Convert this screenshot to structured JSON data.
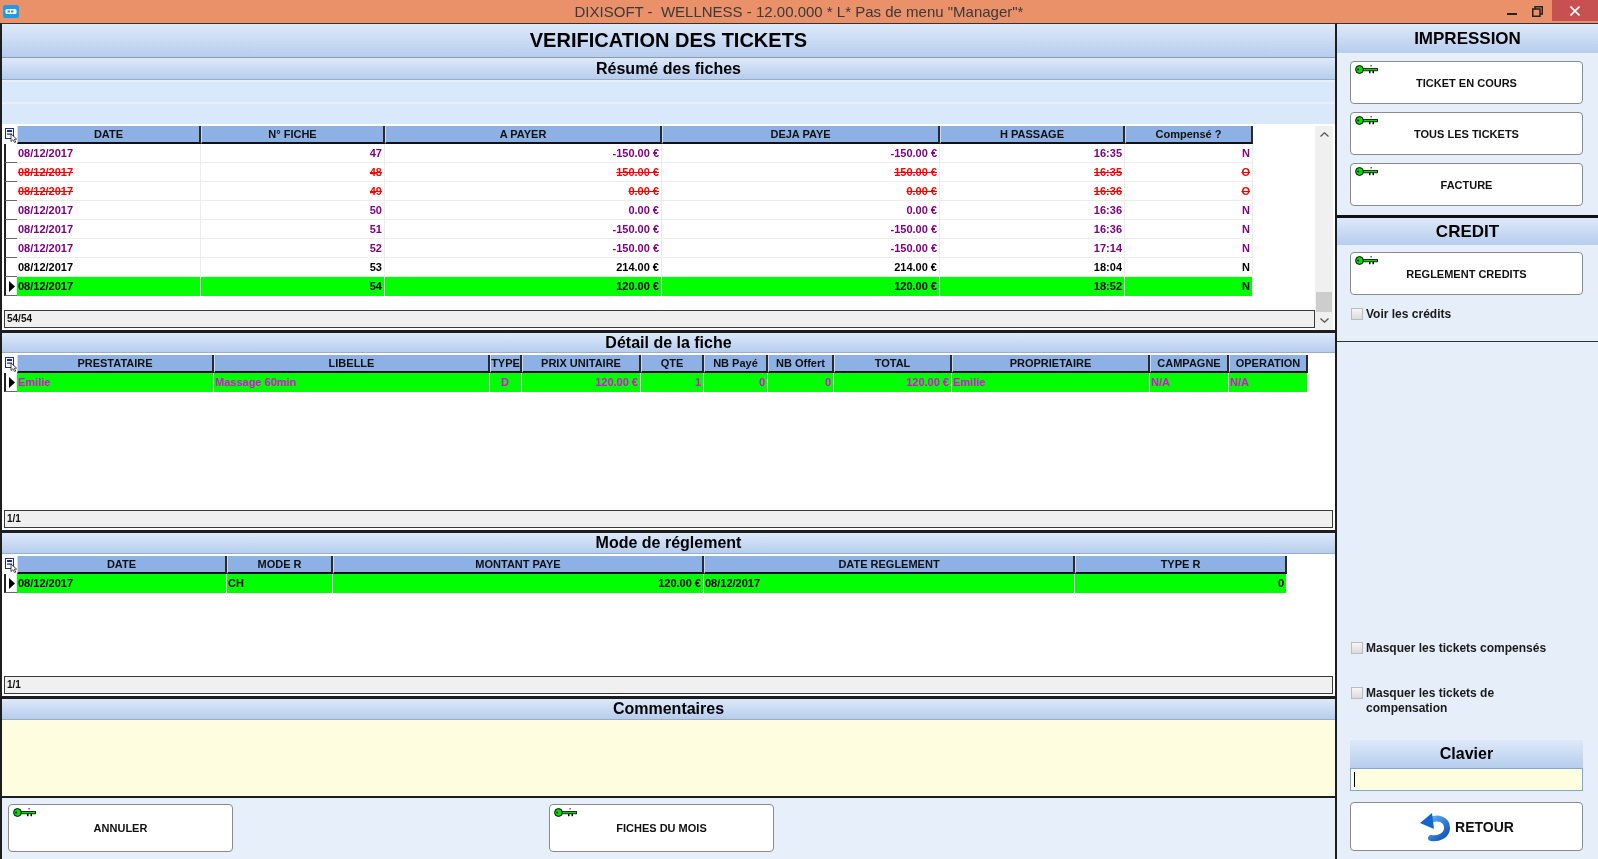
{
  "window": {
    "title": "DIXISOFT -  WELLNESS - 12.00.000 * L* Pas de menu \"Manager\"*"
  },
  "page_title": "VERIFICATION DES TICKETS",
  "summary": {
    "title": "Résumé des fiches",
    "columns": [
      "DATE",
      "N° FICHE",
      "A PAYER",
      "DEJA PAYE",
      "H PASSAGE",
      "Compensé ?"
    ],
    "rows": [
      {
        "cells": [
          "08/12/2017",
          "47",
          "-150.00 €",
          "-150.00 €",
          "16:35",
          "N"
        ],
        "color": "#800080",
        "struck": false,
        "selected": false
      },
      {
        "cells": [
          "08/12/2017",
          "48",
          "150.00 €",
          "150.00 €",
          "16:35",
          "O"
        ],
        "color": "#ff0000",
        "struck": true,
        "selected": false
      },
      {
        "cells": [
          "08/12/2017",
          "49",
          "0.00 €",
          "0.00 €",
          "16:36",
          "O"
        ],
        "color": "#ff0000",
        "struck": true,
        "selected": false
      },
      {
        "cells": [
          "08/12/2017",
          "50",
          "0.00 €",
          "0.00 €",
          "16:36",
          "N"
        ],
        "color": "#800080",
        "struck": false,
        "selected": false
      },
      {
        "cells": [
          "08/12/2017",
          "51",
          "-150.00 €",
          "-150.00 €",
          "16:36",
          "N"
        ],
        "color": "#800080",
        "struck": false,
        "selected": false
      },
      {
        "cells": [
          "08/12/2017",
          "52",
          "-150.00 €",
          "-150.00 €",
          "17:14",
          "N"
        ],
        "color": "#800080",
        "struck": false,
        "selected": false
      },
      {
        "cells": [
          "08/12/2017",
          "53",
          "214.00 €",
          "214.00 €",
          "18:04",
          "N"
        ],
        "color": "#000000",
        "struck": false,
        "selected": false
      },
      {
        "cells": [
          "08/12/2017",
          "54",
          "120.00 €",
          "120.00 €",
          "18:52",
          "N"
        ],
        "struck": false,
        "selected": true
      }
    ],
    "record_count": "54/54"
  },
  "detail": {
    "title": "Détail de la fiche",
    "columns": [
      "PRESTATAIRE",
      "LIBELLE",
      "TYPE",
      "PRIX UNITAIRE",
      "QTE",
      "NB Payé",
      "NB Offert",
      "TOTAL",
      "PROPRIETAIRE",
      "CAMPAGNE",
      "OPERATION"
    ],
    "rows": [
      {
        "cells": [
          "Emilie",
          "Massage 60min",
          "D",
          "120.00 €",
          "1",
          "0",
          "0",
          "120.00 €",
          "Emilie",
          "N/A",
          "N/A"
        ],
        "selected": true
      }
    ],
    "record_count": "1/1"
  },
  "payments": {
    "title": "Mode de réglement",
    "columns": [
      "DATE",
      "MODE R",
      "MONTANT PAYE",
      "DATE REGLEMENT",
      "TYPE R"
    ],
    "rows": [
      {
        "cells": [
          "08/12/2017",
          "CH",
          "120.00 €",
          "08/12/2017",
          "0"
        ],
        "selected": true
      }
    ],
    "record_count": "1/1"
  },
  "comments": {
    "title": "Commentaires"
  },
  "bottom_buttons": [
    "ANNULER",
    "FICHES DU MOIS"
  ],
  "print": {
    "title": "IMPRESSION",
    "buttons": [
      "TICKET EN COURS",
      "TOUS LES TICKETS",
      "FACTURE"
    ]
  },
  "credit": {
    "title": "CREDIT",
    "buttons": [
      "REGLEMENT CREDITS"
    ],
    "checkbox": {
      "label": "Voir les crédits",
      "checked": false
    }
  },
  "filters": [
    {
      "label": "Masquer les tickets compensés",
      "checked": false
    },
    {
      "label": "Masquer les tickets de compensation",
      "checked": false
    }
  ],
  "keyboard": {
    "title": "Clavier"
  },
  "return_button": "RETOUR"
}
